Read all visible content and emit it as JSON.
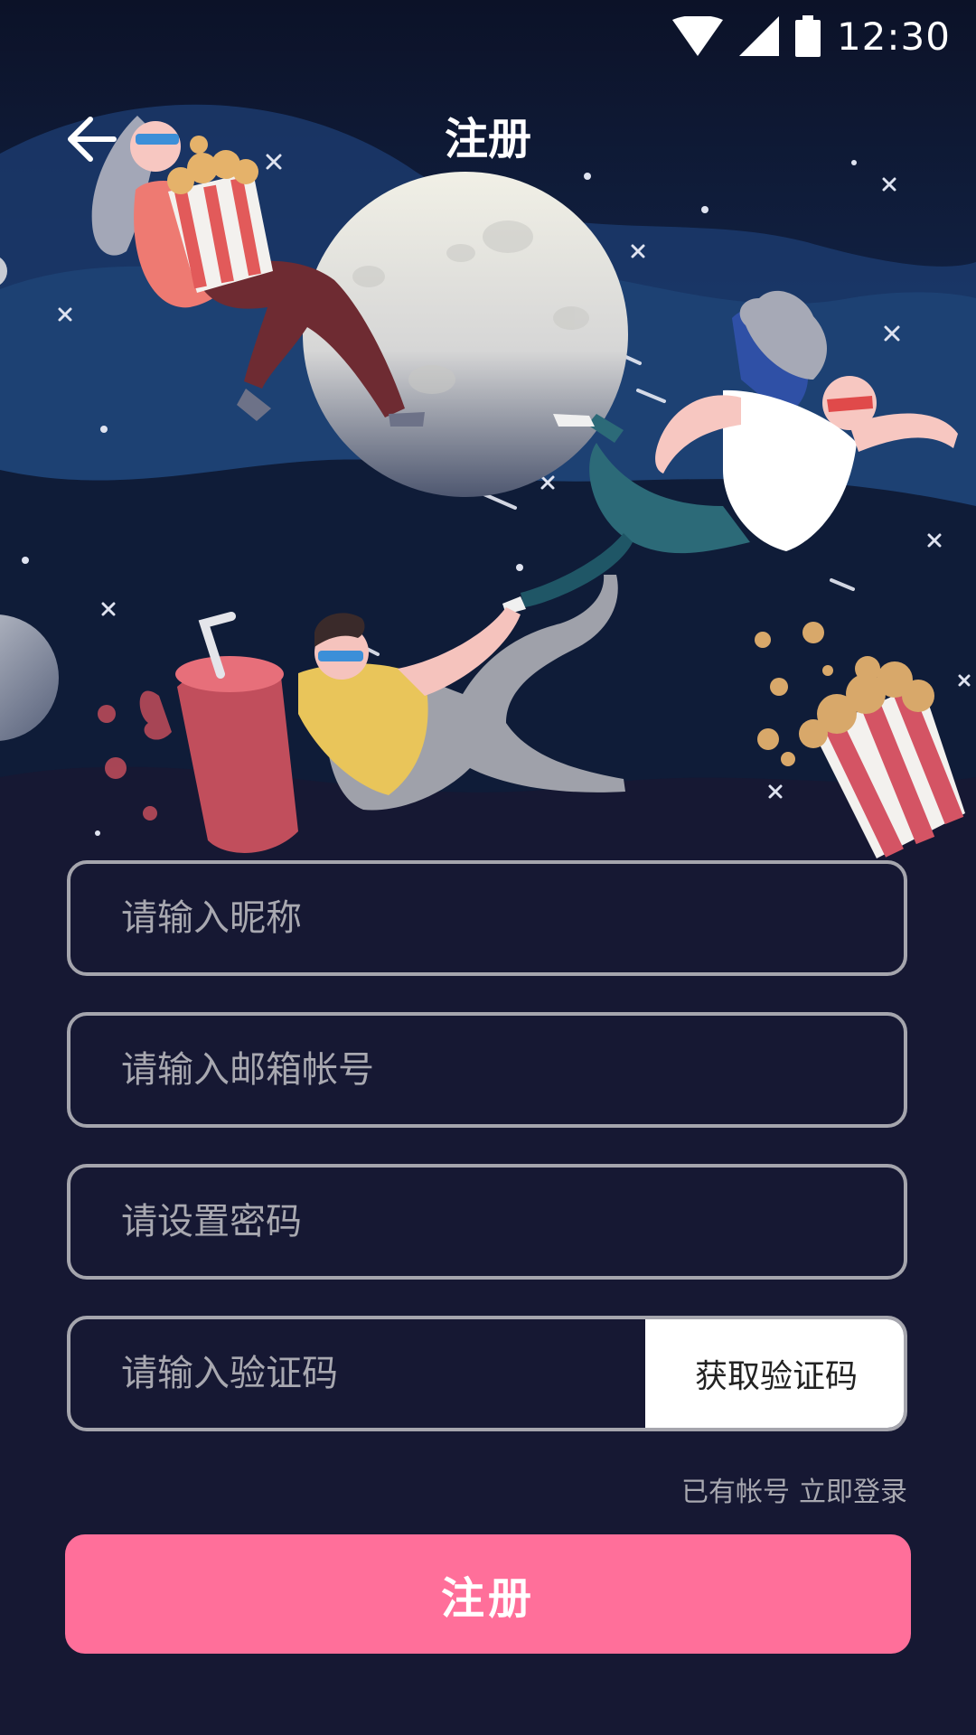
{
  "status_bar": {
    "time": "12:30",
    "icons": [
      "wifi-icon",
      "signal-icon",
      "battery-icon"
    ]
  },
  "header": {
    "title": "注册",
    "back_icon": "arrow-left-icon"
  },
  "illustration": {
    "subject": "people floating in space with popcorn, drinks and a moon"
  },
  "form": {
    "nickname_placeholder": "请输入昵称",
    "email_placeholder": "请输入邮箱帐号",
    "password_placeholder": "请设置密码",
    "code_placeholder": "请输入验证码",
    "get_code_label": "获取验证码",
    "have_account_text": "已有帐号",
    "login_link": "立即登录",
    "submit_label": "注册"
  },
  "colors": {
    "background": "#161833",
    "accent": "#ff6f9a",
    "field_border": "#a5a5ad",
    "placeholder": "#a8a8b0"
  }
}
